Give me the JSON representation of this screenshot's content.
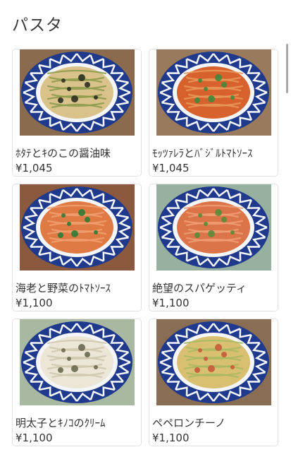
{
  "page": {
    "title": "パスタ"
  },
  "items": [
    {
      "name": "ﾎﾀﾃとｷのこの醤油味",
      "price": "¥1,045",
      "sauce": "#d9c38a",
      "sauce2": "#8a9a4a",
      "topping": "#2a2f20",
      "table": "#8a6b4e"
    },
    {
      "name": "ﾓｯﾂｧﾚﾗとﾊﾞｼﾞﾙﾄﾏﾄｿｰｽ",
      "price": "¥1,045",
      "sauce": "#d8622e",
      "sauce2": "#e89a5a",
      "topping": "#3f8a3a",
      "table": "#9a7a5c"
    },
    {
      "name": "海老と野菜のﾄﾏﾄｿｰｽ",
      "price": "¥1,100",
      "sauce": "#e07a45",
      "sauce2": "#f0a070",
      "topping": "#2f7a34",
      "table": "#8b5a3e"
    },
    {
      "name": "絶望のスパゲッティ",
      "price": "¥1,100",
      "sauce": "#db7448",
      "sauce2": "#eea074",
      "topping": "#5a8a38",
      "table": "#97b0a0"
    },
    {
      "name": "明太子とｷﾉｺのｸﾘｰﾑ",
      "price": "¥1,100",
      "sauce": "#ece6d6",
      "sauce2": "#cfc6ad",
      "topping": "#6a6a50",
      "table": "#a9b8a0"
    },
    {
      "name": "ペペロンチーノ",
      "price": "¥1,100",
      "sauce": "#d8c070",
      "sauce2": "#a8b860",
      "topping": "#c65a3a",
      "table": "#8a6e54"
    }
  ],
  "colors": {
    "plate_blue": "#1f3a8c",
    "plate_white": "#f4f6fa"
  }
}
